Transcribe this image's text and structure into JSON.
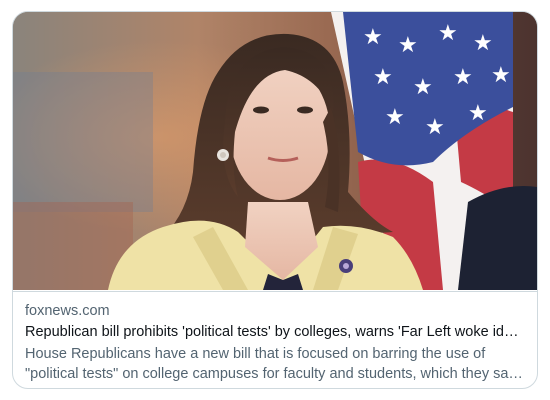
{
  "link_card": {
    "domain": "foxnews.com",
    "title": "Republican bill prohibits 'political tests' by colleges, warns 'Far Left woke ideol...",
    "description": "House Republicans have a new bill that is focused on barring the use of \"political tests\" on college campuses for faculty and students, which they say is stifling t...",
    "image_icon": "news-photo-woman-with-american-flag"
  },
  "colors": {
    "border": "#cfd9de",
    "domain_text": "#536471",
    "title_text": "#0f1419",
    "description_text": "#536471"
  }
}
